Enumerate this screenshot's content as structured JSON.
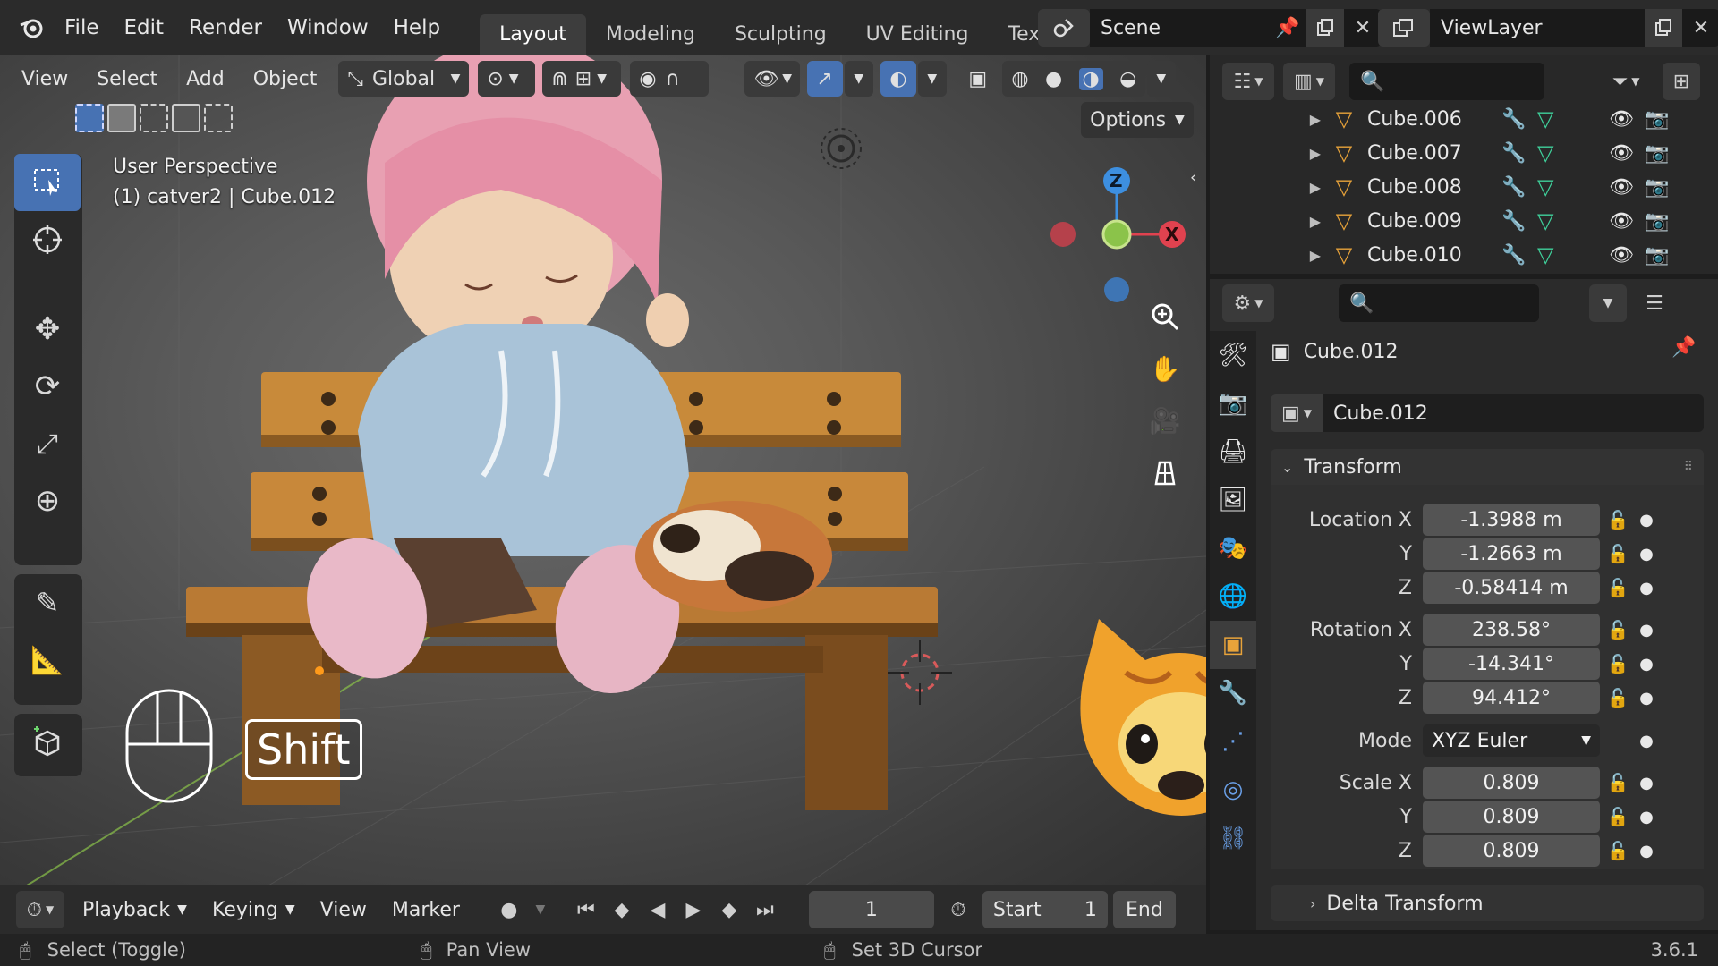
{
  "topbar": {
    "menu": [
      "File",
      "Edit",
      "Render",
      "Window",
      "Help"
    ],
    "workspaces": [
      "Layout",
      "Modeling",
      "Sculpting",
      "UV Editing",
      "Texture Pai"
    ],
    "scene": "Scene",
    "view_layer": "ViewLayer"
  },
  "viewport": {
    "menu": [
      "View",
      "Select",
      "Add",
      "Object"
    ],
    "orientation": "Global",
    "options_label": "Options",
    "view_name": "User Perspective",
    "object_info": "(1) catver2 | Cube.012",
    "key_overlay": "Shift",
    "gizmo": {
      "z": "Z",
      "x": "X"
    }
  },
  "outliner": {
    "items": [
      {
        "name": "Cube.006"
      },
      {
        "name": "Cube.007"
      },
      {
        "name": "Cube.008"
      },
      {
        "name": "Cube.009"
      },
      {
        "name": "Cube.010"
      }
    ]
  },
  "properties": {
    "object_title": "Cube.012",
    "object_name": "Cube.012",
    "panel_transform": "Transform",
    "panel_delta": "Delta Transform",
    "location_label": "Location X",
    "rotation_label": "Rotation X",
    "scale_label": "Scale X",
    "y_label": "Y",
    "z_label": "Z",
    "mode_label": "Mode",
    "location": {
      "x": "-1.3988 m",
      "y": "-1.2663 m",
      "z": "-0.58414 m"
    },
    "rotation": {
      "x": "238.58°",
      "y": "-14.341°",
      "z": "94.412°"
    },
    "mode": "XYZ Euler",
    "scale": {
      "x": "0.809",
      "y": "0.809",
      "z": "0.809"
    }
  },
  "timeline": {
    "menu": [
      "Playback",
      "Keying",
      "View",
      "Marker"
    ],
    "current_frame": "1",
    "start_label": "Start",
    "start_value": "1",
    "end_label": "End"
  },
  "status": {
    "left_action": "Select (Toggle)",
    "middle_action": "Pan View",
    "right_action": "Set 3D Cursor",
    "version": "3.6.1"
  },
  "colors": {
    "accent": "#4772b3",
    "outliner_object": "#e8a33a",
    "mesh_icon": "#3fd19b",
    "wrench_icon": "#6aa0e8",
    "axis_x": "#e0424f",
    "axis_y": "#8bc34a",
    "axis_z": "#3d8fe0"
  }
}
